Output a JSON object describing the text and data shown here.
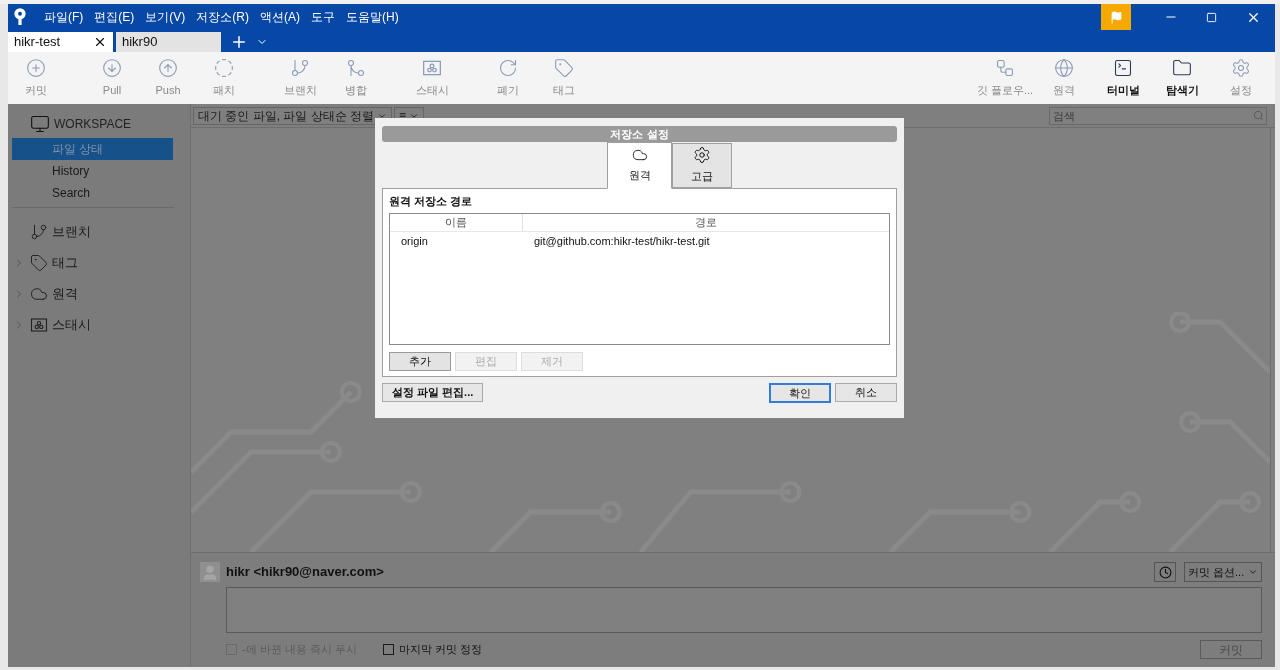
{
  "menu": [
    "파일(F)",
    "편집(E)",
    "보기(V)",
    "저장소(R)",
    "액션(A)",
    "도구",
    "도움말(H)"
  ],
  "tabs": [
    {
      "label": "hikr-test",
      "selected": true
    },
    {
      "label": "hikr90",
      "selected": false
    }
  ],
  "toolbar": {
    "left": [
      {
        "kind": "commit",
        "label": "커밋",
        "disabled": true
      },
      {
        "kind": "pull",
        "label": "Pull",
        "disabled": true
      },
      {
        "kind": "push",
        "label": "Push",
        "disabled": true
      },
      {
        "kind": "fetch",
        "label": "패치",
        "disabled": true
      },
      {
        "kind": "branch",
        "label": "브랜치",
        "disabled": true
      },
      {
        "kind": "merge",
        "label": "병합",
        "disabled": true
      },
      {
        "kind": "stash",
        "label": "스태시",
        "disabled": true
      },
      {
        "kind": "discard",
        "label": "폐기",
        "disabled": true
      },
      {
        "kind": "tag",
        "label": "태그",
        "disabled": true
      }
    ],
    "right": [
      {
        "kind": "flow",
        "label": "깃 플로우...",
        "disabled": true
      },
      {
        "kind": "remote",
        "label": "원격",
        "disabled": true
      },
      {
        "kind": "terminal",
        "label": "터미널",
        "disabled": false
      },
      {
        "kind": "explorer",
        "label": "탐색기",
        "disabled": false
      },
      {
        "kind": "settings",
        "label": "설정",
        "disabled": true
      }
    ]
  },
  "sidebar": {
    "workspace": "WORKSPACE",
    "items": [
      {
        "label": "파일 상태",
        "selected": true
      },
      {
        "label": "History",
        "selected": false
      },
      {
        "label": "Search",
        "selected": false
      }
    ],
    "sections": [
      {
        "kind": "branch",
        "label": "브랜치",
        "expandable": false
      },
      {
        "kind": "tag",
        "label": "태그",
        "expandable": true
      },
      {
        "kind": "remote",
        "label": "원격",
        "expandable": true
      },
      {
        "kind": "stash",
        "label": "스태시",
        "expandable": true
      }
    ]
  },
  "file_filter": "대기 중인 파일, 파일 상태순 정렬",
  "view_menu": "≡",
  "search": {
    "placeholder": "검색"
  },
  "dialog": {
    "title": "저장소 설정",
    "tabs": [
      {
        "kind": "remote",
        "label": "원격",
        "selected": true
      },
      {
        "kind": "advanced",
        "label": "고급",
        "selected": false
      }
    ],
    "section_title": "원격 저장소 경로",
    "table": {
      "columns": [
        "이름",
        "경로"
      ],
      "rows": [
        [
          "origin",
          "git@github.com:hikr-test/hikr-test.git"
        ]
      ]
    },
    "list_buttons": [
      {
        "label": "추가",
        "disabled": false
      },
      {
        "label": "편집",
        "disabled": true
      },
      {
        "label": "제거",
        "disabled": true
      }
    ],
    "edit_config": "설정 파일 편집...",
    "ok": "확인",
    "cancel": "취소"
  },
  "commit": {
    "author": "hikr <hikr90@naver.com>",
    "options": "커밋 옵션...",
    "checks": [
      {
        "label": "-에 바뀐 내용 즉시 푸시",
        "checked": false,
        "disabled": true
      },
      {
        "label": "마지막 커밋 정정",
        "checked": false,
        "disabled": false
      }
    ],
    "button": {
      "label": "커밋",
      "disabled": true
    }
  }
}
